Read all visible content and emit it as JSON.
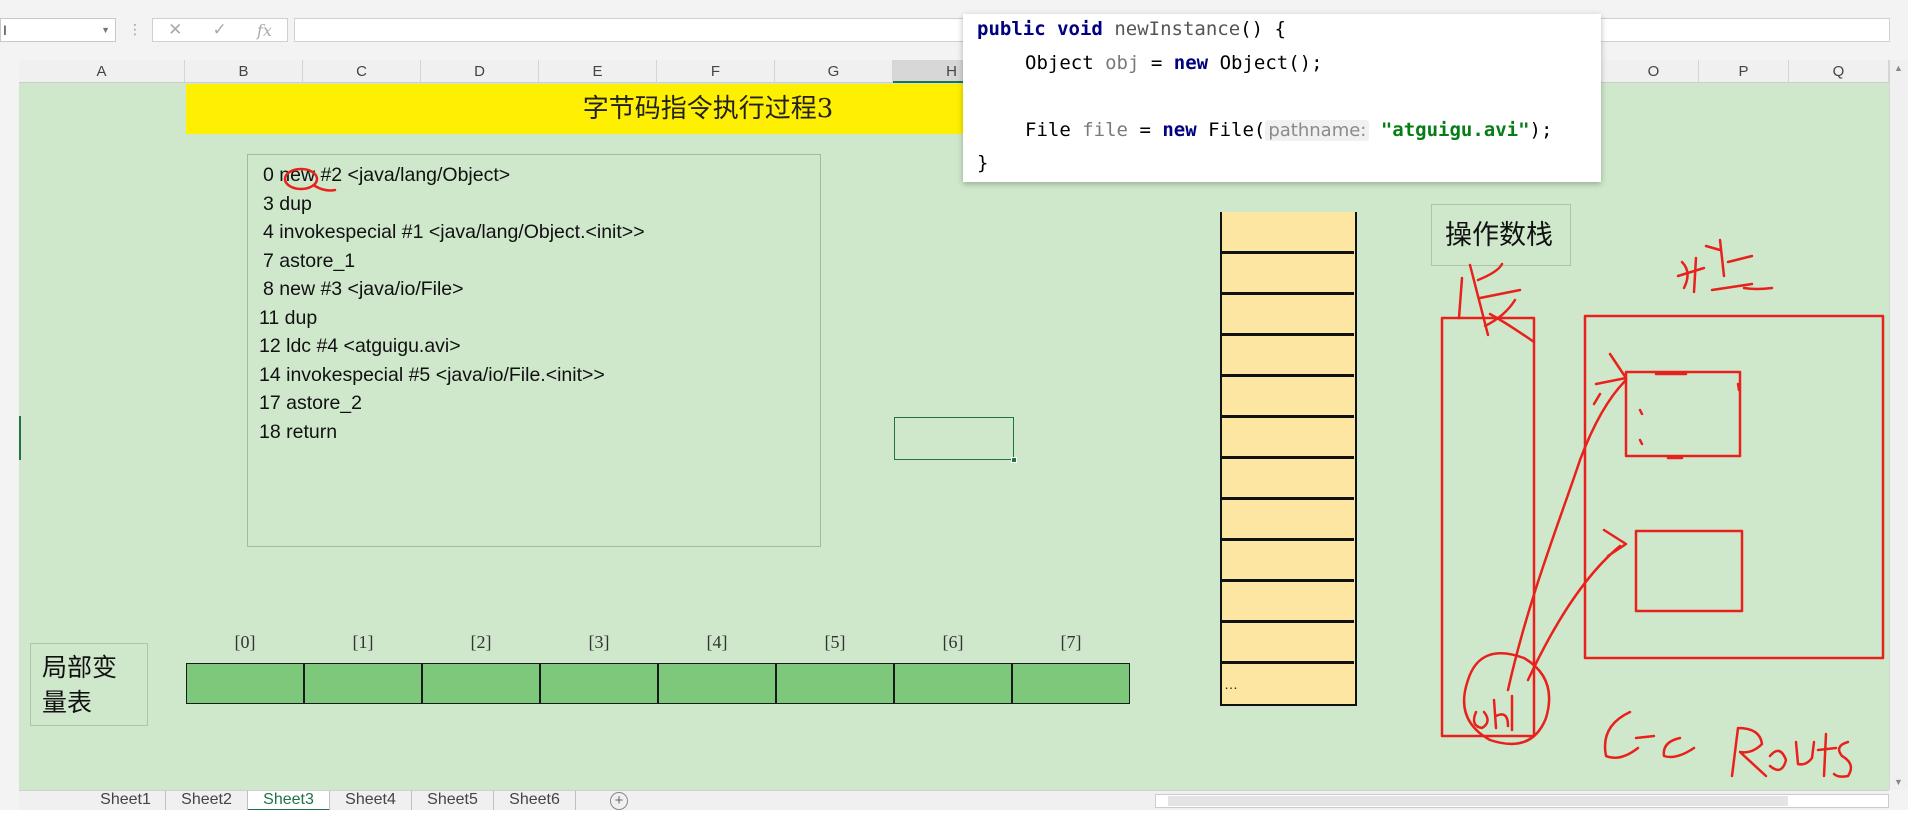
{
  "namebox": {
    "value": "I"
  },
  "formula_bar": {
    "cancel_icon": "✕",
    "enter_icon": "✓",
    "fx_label": "fx",
    "value": ""
  },
  "columns": [
    {
      "label": "A",
      "selected": false
    },
    {
      "label": "B",
      "selected": false
    },
    {
      "label": "C",
      "selected": false
    },
    {
      "label": "D",
      "selected": false
    },
    {
      "label": "E",
      "selected": false
    },
    {
      "label": "F",
      "selected": false
    },
    {
      "label": "G",
      "selected": false
    },
    {
      "label": "H",
      "selected": true
    },
    {
      "label": "O",
      "selected": false
    },
    {
      "label": "P",
      "selected": false
    },
    {
      "label": "Q",
      "selected": false
    }
  ],
  "title": "字节码指令执行过程3",
  "bytecode": [
    "0 new #2 <java/lang/Object>",
    "3 dup",
    "4 invokespecial #1 <java/lang/Object.<init>>",
    "7 astore_1",
    "8 new #3 <java/io/File>",
    "11 dup",
    "12 ldc #4 <atguigu.avi>",
    "14 invokespecial #5 <java/io/File.<init>>",
    "17 astore_2",
    "18 return"
  ],
  "operand_stack": {
    "label": "操作数栈",
    "slot_count": 12,
    "ellipsis": "…"
  },
  "local_vars": {
    "label_line1": "局部变",
    "label_line2": "量表",
    "indices": [
      "[0]",
      "[1]",
      "[2]",
      "[3]",
      "[4]",
      "[5]",
      "[6]",
      "[7]"
    ]
  },
  "popup_code": {
    "kw_public": "public",
    "kw_void": "void",
    "method": "newInstance",
    "open": "() {",
    "type_object": "Object",
    "var_obj": "obj",
    "kw_new": "new",
    "ctor_object": "Object();",
    "type_file": "File",
    "var_file": "file",
    "ctor_file": "File(",
    "param_hint": "pathname:",
    "string_arg": "\"atguigu.avi\"",
    "close_call": ");",
    "close_brace": "}",
    "assign": "="
  },
  "sheet_tabs": [
    {
      "label": "Sheet1",
      "active": false
    },
    {
      "label": "Sheet2",
      "active": false
    },
    {
      "label": "Sheet3",
      "active": true
    },
    {
      "label": "Sheet4",
      "active": false
    },
    {
      "label": "Sheet5",
      "active": false
    },
    {
      "label": "Sheet6",
      "active": false
    }
  ],
  "add_sheet_icon": "+",
  "annotation_color": "#e8211c"
}
